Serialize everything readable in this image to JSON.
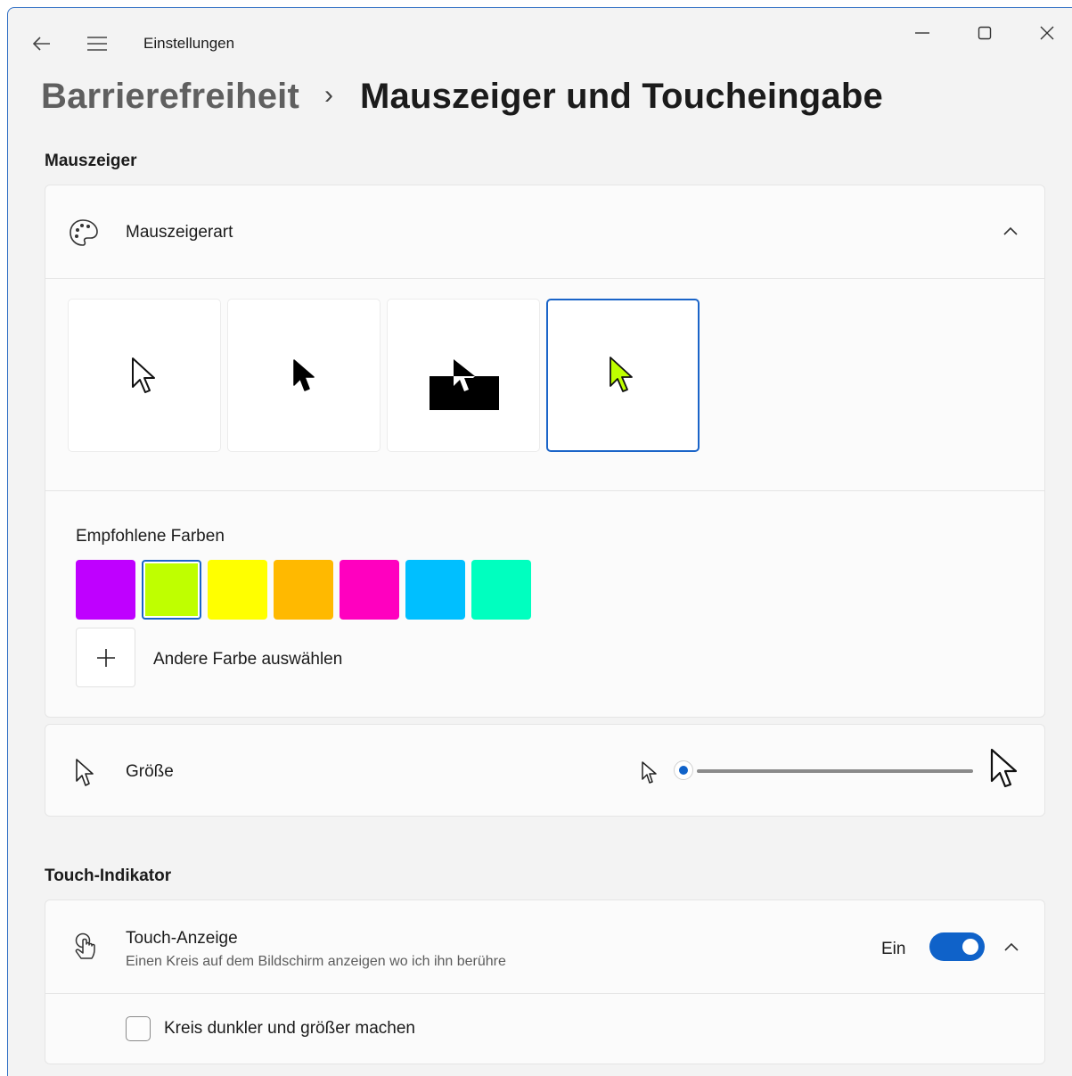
{
  "window": {
    "title": "Einstellungen",
    "border_color": "#2f6ec4"
  },
  "breadcrumb": {
    "root": "Barrierefreiheit",
    "separator": "›",
    "current": "Mauszeiger und Toucheingabe"
  },
  "sections": {
    "pointer": {
      "title": "Mauszeiger",
      "style_row": {
        "label": "Mauszeigerart",
        "icon": "palette-icon",
        "expanded": true,
        "styles": [
          {
            "name": "white",
            "selected": false
          },
          {
            "name": "black",
            "selected": false
          },
          {
            "name": "inverted",
            "selected": false
          },
          {
            "name": "custom",
            "selected": true
          }
        ]
      },
      "colors": {
        "label": "Empfohlene Farben",
        "swatches": [
          "#bf00ff",
          "#bfff00",
          "#ffff00",
          "#ffb900",
          "#ff00bf",
          "#00bfff",
          "#00ffbf"
        ],
        "selected_index": 1,
        "add_label": "Andere Farbe auswählen",
        "add_icon": "plus-icon"
      },
      "size_row": {
        "label": "Größe",
        "icon": "cursor-icon",
        "slider_value": 0
      }
    },
    "touch": {
      "title": "Touch-Indikator",
      "indicator_row": {
        "label": "Touch-Anzeige",
        "description": "Einen Kreis auf dem Bildschirm anzeigen wo ich ihn berühre",
        "state_label": "Ein",
        "toggle_on": true,
        "icon": "touch-icon",
        "expanded": true
      },
      "darker_option": {
        "label": "Kreis dunkler und größer machen",
        "checked": false
      }
    }
  },
  "colors": {
    "accent": "#0f62c9",
    "selected_border": "#1a64c8",
    "custom_cursor": "#bfff00"
  }
}
